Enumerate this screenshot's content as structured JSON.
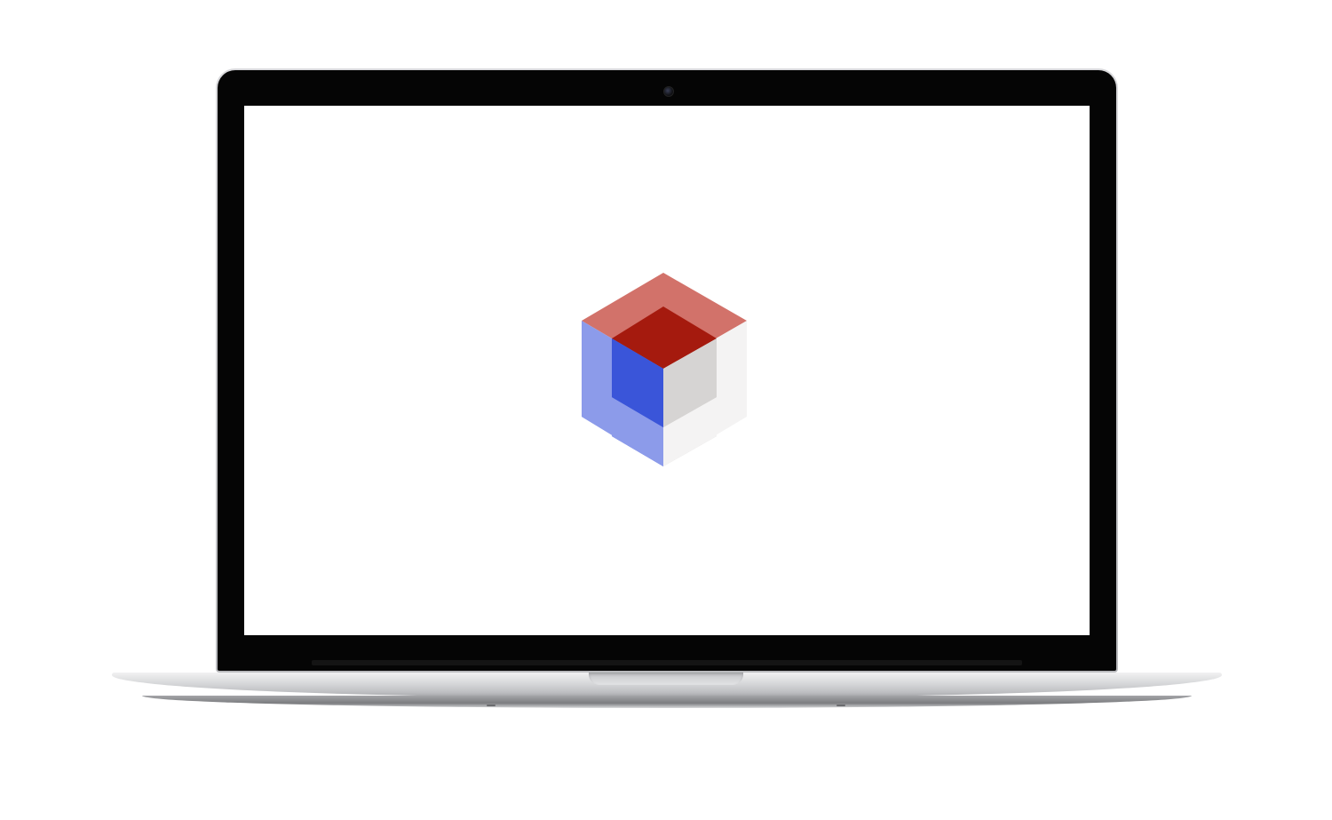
{
  "colors": {
    "cube_red_light": "#d2726a",
    "cube_red_dark": "#a51a0e",
    "cube_blue_light": "#8c9bea",
    "cube_blue_dark": "#3a55d9",
    "cube_gray_light": "#f4f3f3",
    "cube_gray_dark": "#d6d4d3",
    "bezel": "#050505",
    "screen_background": "#ffffff"
  },
  "icons": {
    "camera": "webcam-icon",
    "logo": "cube-logo-icon"
  }
}
